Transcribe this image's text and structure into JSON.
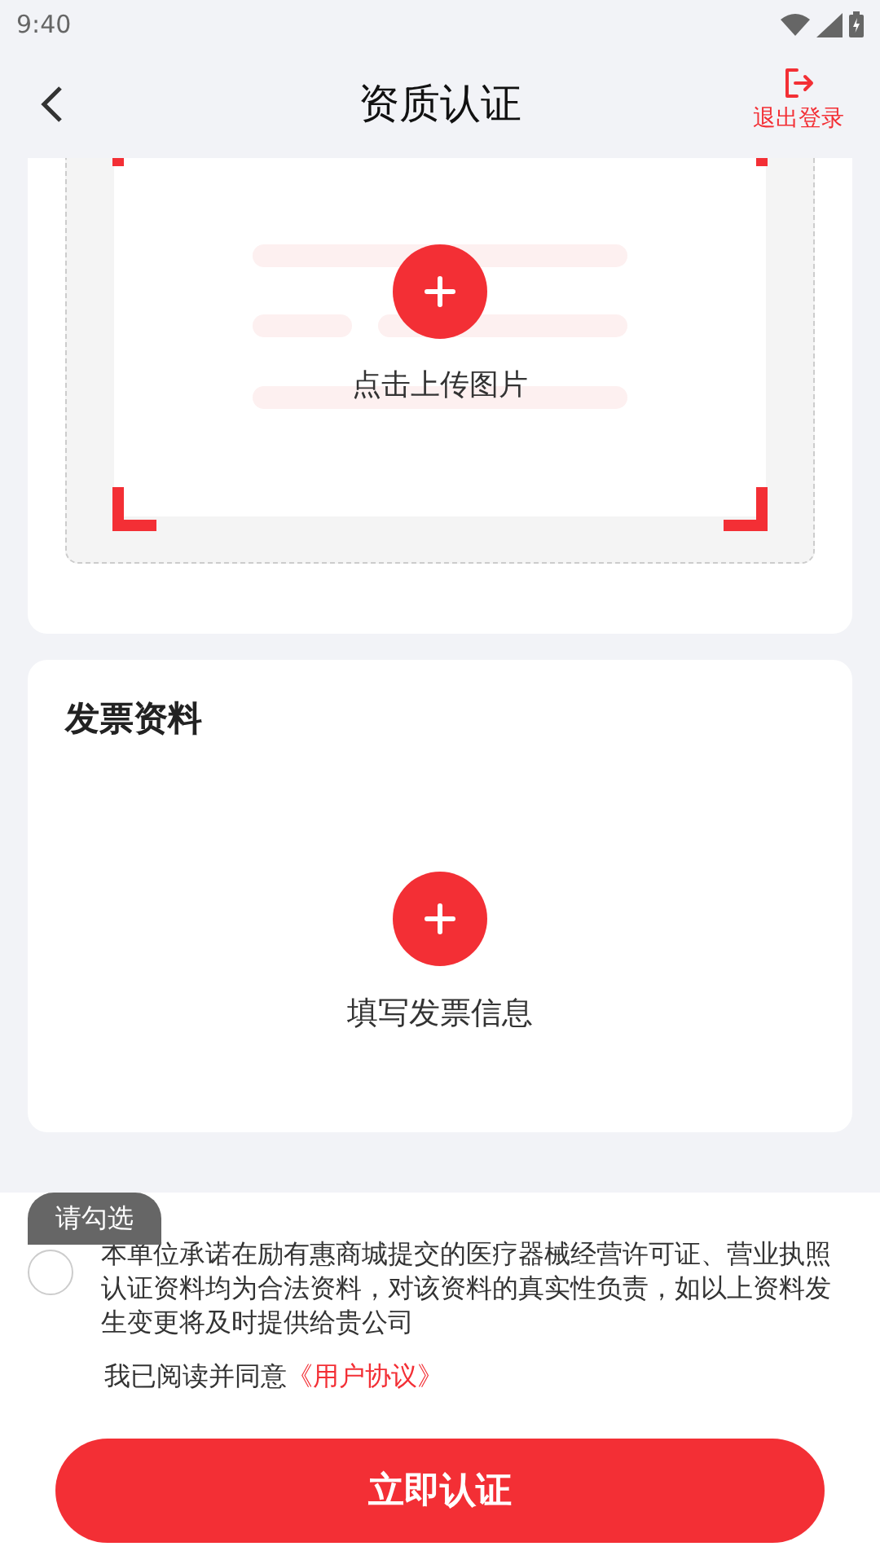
{
  "status_bar": {
    "time": "9:40"
  },
  "header": {
    "title": "资质认证",
    "logout_label": "退出登录"
  },
  "upload_card": {
    "upload_label": "点击上传图片"
  },
  "invoice_card": {
    "title": "发票资料",
    "add_label": "填写发票信息"
  },
  "agreement": {
    "tooltip": "请勾选",
    "checked": false,
    "text": "本单位承诺在励有惠商城提交的医疗器械经营许可证、营业执照认证资料均为合法资料，对该资料的真实性负责，如以上资料发生变更将及时提供给贵公司",
    "read_prefix": "我已阅读并同意",
    "link": "《用户协议》"
  },
  "submit_button": "立即认证"
}
